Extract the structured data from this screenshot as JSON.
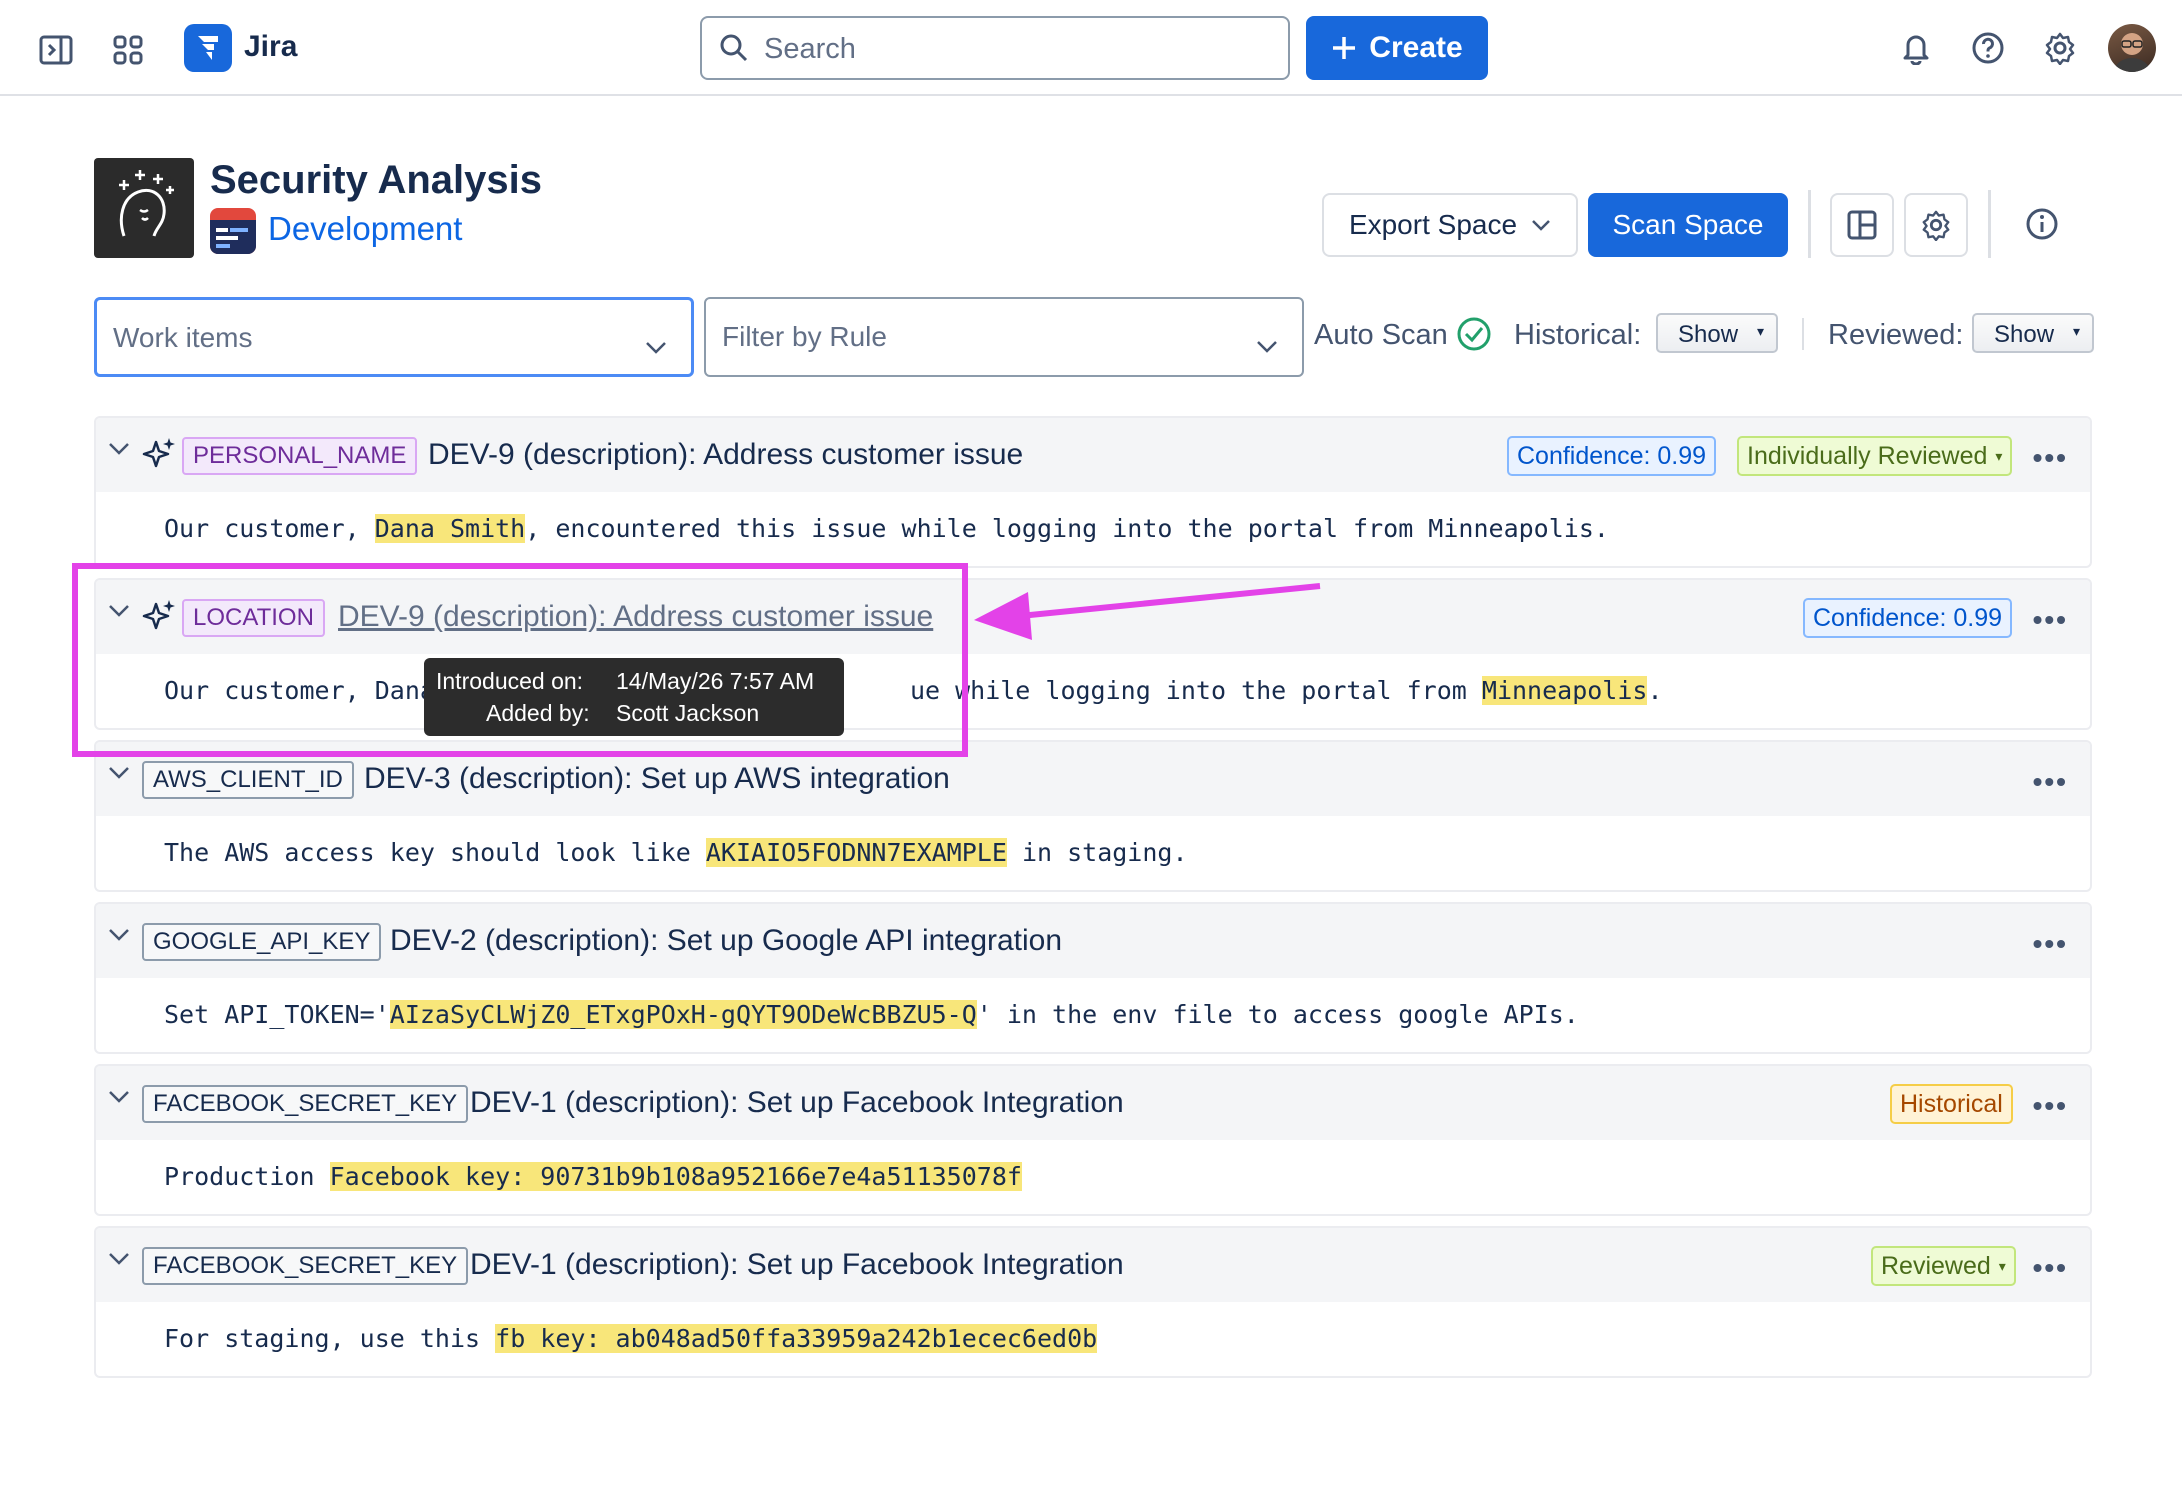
{
  "topbar": {
    "app_name": "Jira",
    "search_placeholder": "Search",
    "create_label": "Create"
  },
  "page": {
    "title": "Security Analysis",
    "space_name": "Development",
    "export_label": "Export Space",
    "scan_label": "Scan Space"
  },
  "filters": {
    "work_items": "Work items",
    "filter_rule": "Filter by Rule",
    "auto_scan": "Auto Scan",
    "historical_label": "Historical:",
    "historical_value": "Show",
    "reviewed_label": "Reviewed:",
    "reviewed_value": "Show"
  },
  "findings": [
    {
      "tag": "PERSONAL_NAME",
      "title": "DEV-9 (description): Address customer issue",
      "confidence": "Confidence: 0.99",
      "status": "Individually Reviewed",
      "text_pre": "Our customer, ",
      "text_hl": "Dana Smith",
      "text_post": ", encountered this issue while logging into the portal from Minneapolis."
    },
    {
      "tag": "LOCATION",
      "title": "DEV-9 (description): Address customer issue",
      "confidence": "Confidence: 0.99",
      "text_pre_a": "Our customer, Dana",
      "text_pre_b": "ue while logging into the portal from ",
      "text_hl": "Minneapolis",
      "text_post": "."
    },
    {
      "tag": "AWS_CLIENT_ID",
      "title": "DEV-3 (description): Set up AWS integration",
      "text_pre": "The AWS access key should look like ",
      "text_hl": "AKIAIO5FODNN7EXAMPLE",
      "text_post": " in staging."
    },
    {
      "tag": "GOOGLE_API_KEY",
      "title": "DEV-2 (description): Set up Google API integration",
      "text_pre": "Set API_TOKEN='",
      "text_hl": "AIzaSyCLWjZ0_ETxgPOxH-gQYT9ODeWcBBZU5-Q",
      "text_post": "' in the env file to access google APIs."
    },
    {
      "tag": "FACEBOOK_SECRET_KEY",
      "title": "DEV-1 (description): Set up Facebook Integration",
      "status": "Historical",
      "text_pre": "Production ",
      "text_hl": "Facebook key: 90731b9b108a952166e7e4a51135078f",
      "text_post": ""
    },
    {
      "tag": "FACEBOOK_SECRET_KEY",
      "title": "DEV-1 (description): Set up Facebook Integration",
      "status": "Reviewed",
      "text_pre": "For staging, use this ",
      "text_hl": "fb key: ab048ad50ffa33959a242b1ecec6ed0b",
      "text_post": ""
    }
  ],
  "tooltip": {
    "introduced_label": "Introduced on:",
    "introduced_value": "14/May/26 7:57 AM",
    "added_label": "Added by:",
    "added_value": "Scott Jackson"
  },
  "colors": {
    "brand": "#1868db",
    "annotation": "#e342e8",
    "highlight": "#f8e67a"
  }
}
